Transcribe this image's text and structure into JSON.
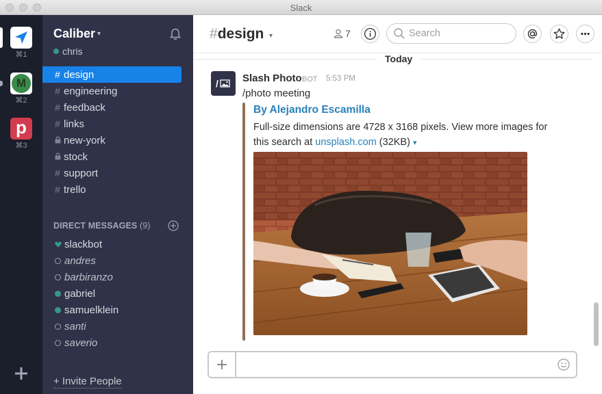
{
  "window": {
    "title": "Slack"
  },
  "teams": [
    {
      "name": "team-1",
      "shortcut": "⌘1",
      "color": "#ffffff",
      "letter": ""
    },
    {
      "name": "team-2",
      "shortcut": "⌘2",
      "color": "#3a8a4a",
      "letter": "M"
    },
    {
      "name": "team-3",
      "shortcut": "⌘3",
      "color": "#d33c4e",
      "letter": "p"
    }
  ],
  "sidebar": {
    "team_name": "Caliber",
    "user": "chris",
    "channels": [
      {
        "label": "design",
        "type": "public",
        "active": true
      },
      {
        "label": "engineering",
        "type": "public"
      },
      {
        "label": "feedback",
        "type": "public"
      },
      {
        "label": "links",
        "type": "public"
      },
      {
        "label": "new-york",
        "type": "private"
      },
      {
        "label": "stock",
        "type": "private"
      },
      {
        "label": "support",
        "type": "public"
      },
      {
        "label": "trello",
        "type": "public"
      }
    ],
    "dm_header": "DIRECT MESSAGES",
    "dm_count": "(9)",
    "dms": [
      {
        "label": "slackbot",
        "status": "heart"
      },
      {
        "label": "andres",
        "status": "away"
      },
      {
        "label": "barbiranzo",
        "status": "away"
      },
      {
        "label": "gabriel",
        "status": "online"
      },
      {
        "label": "samuelklein",
        "status": "online"
      },
      {
        "label": "santi",
        "status": "away"
      },
      {
        "label": "saverio",
        "status": "away"
      }
    ],
    "invite_label": "+ Invite People"
  },
  "header": {
    "hash": "#",
    "channel": "design",
    "member_count": "7",
    "search_placeholder": "Search"
  },
  "messages": {
    "day_label": "Today",
    "sender": "Slash Photo",
    "bot_tag": "BOT",
    "time": "5:53 PM",
    "text": "/photo meeting",
    "avatar_label": "/",
    "attachment": {
      "title": "By Alejandro Escamilla",
      "desc_prefix": "Full-size dimensions are 4728 x 3168 pixels. View more images for this search at ",
      "link_text": "unsplash.com",
      "size_text": " (32KB)"
    }
  },
  "colors": {
    "sidebar_bg": "#2f3249",
    "teams_bg": "#1b1e2b",
    "active_channel": "#1782e8",
    "presence": "#38978d",
    "link": "#2a80b9",
    "attachment_bar": "#8f705a"
  }
}
